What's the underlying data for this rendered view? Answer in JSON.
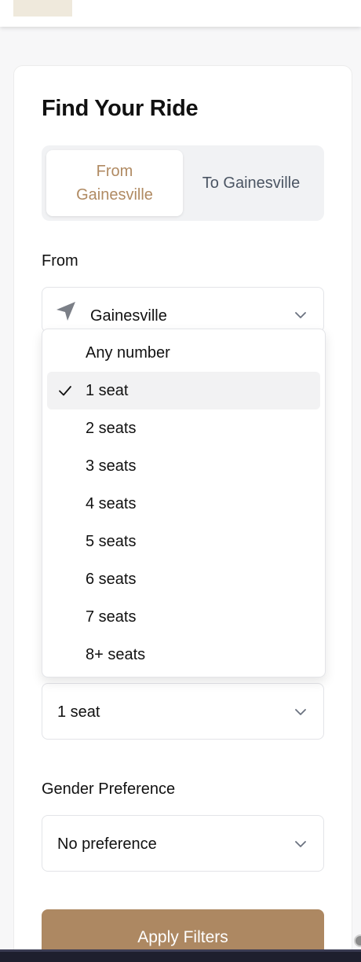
{
  "header": {
    "logo": "logo-placeholder"
  },
  "form": {
    "title": "Find Your Ride",
    "direction_toggle": {
      "options": [
        "From Gainesville",
        "To Gainesville"
      ],
      "active": "From Gainesville"
    },
    "from": {
      "label": "From",
      "icon": "navigation-arrow-icon",
      "value": "Gainesville"
    },
    "seats": {
      "value": "1 seat",
      "options": [
        "Any number",
        "1 seat",
        "2 seats",
        "3 seats",
        "4 seats",
        "5 seats",
        "6 seats",
        "7 seats",
        "8+ seats"
      ],
      "selected": "1 seat"
    },
    "gender": {
      "label": "Gender Preference",
      "value": "No preference"
    },
    "apply_label": "Apply Filters"
  },
  "colors": {
    "accent": "#ad8862",
    "accent_text": "#b08a62",
    "toggle_bg": "#f1f2f4"
  }
}
